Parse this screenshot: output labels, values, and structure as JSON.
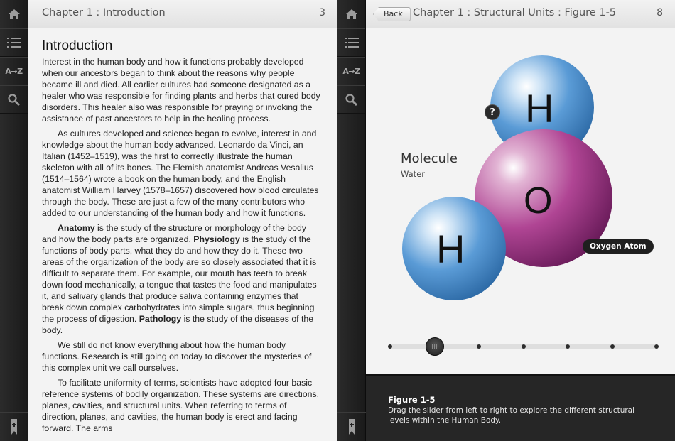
{
  "left_panel": {
    "header": {
      "title": "Chapter 1 : Introduction",
      "page_number": "3"
    },
    "rail": {
      "home_icon": "home-icon",
      "toc_icon": "list-icon",
      "glossary_label": "A→Z",
      "search_icon": "search-icon",
      "bookmark_icon": "bookmark-icon"
    },
    "content": {
      "heading": "Introduction",
      "p1": "Interest in the human body and how it functions probably developed when our ancestors began to think about the reasons why people became ill and died. All earlier cultures had someone designated as a healer who was responsible for finding plants and herbs that cured body disorders. This healer also was responsible for praying or invoking the assistance of past ancestors to help in the healing process.",
      "p2": "As cultures developed and science began to evolve, interest in and knowledge about the human body advanced. Leonardo da Vinci, an Italian (1452–1519), was the first to correctly illustrate the human skeleton with all of its bones. The Flemish anatomist Andreas Vesalius (1514–1564) wrote a book on the human body, and the English anatomist William Harvey (1578–1657) discovered how blood circulates through the body. These are just a few of the many contributors who added to our understanding of the human body and how it functions.",
      "p3_term1": "Anatomy",
      "p3_a": " is the study of the structure or morphology of the body and how the body parts are organized. ",
      "p3_term2": "Physiology",
      "p3_b": " is the study of the functions of body parts, what they do and how they do it. These two areas of the organization of the body are so closely associated that it is difficult to separate them. For example, our mouth has teeth to break down food mechanically, a tongue that tastes the food and manipulates it, and salivary glands that produce saliva containing enzymes that break down complex carbohydrates into simple sugars, thus beginning the process of digestion. ",
      "p3_term3": "Pathology",
      "p3_c": " is the study of the diseases of the body.",
      "p4": "We still do not know everything about how the human body functions. Research is still going on today to discover the mysteries of this complex unit we call ourselves.",
      "p5": "To facilitate uniformity of terms, scientists have adopted four basic reference systems of bodily organization. These systems are directions, planes, cavities, and structural units. When referring to terms of direction, planes, and cavities, the human body is erect and facing forward. The arms"
    }
  },
  "right_panel": {
    "header": {
      "back_label": "Back",
      "title": "Chapter 1 : Structural Units : Figure 1-5",
      "page_number": "8"
    },
    "figure": {
      "molecule_title": "Molecule",
      "molecule_sub": "Water",
      "atom_top": "H",
      "atom_center": "O",
      "atom_left": "H",
      "help_label": "?",
      "tag_label": "Oxygen Atom",
      "slider_stops": 7,
      "slider_position": 1,
      "colors": {
        "hydrogen": "#4a8ccc",
        "oxygen": "#a0307e"
      }
    },
    "caption": {
      "title": "Figure 1-5",
      "text": "Drag the slider from left to right to explore the different structural levels within the Human Body."
    }
  }
}
